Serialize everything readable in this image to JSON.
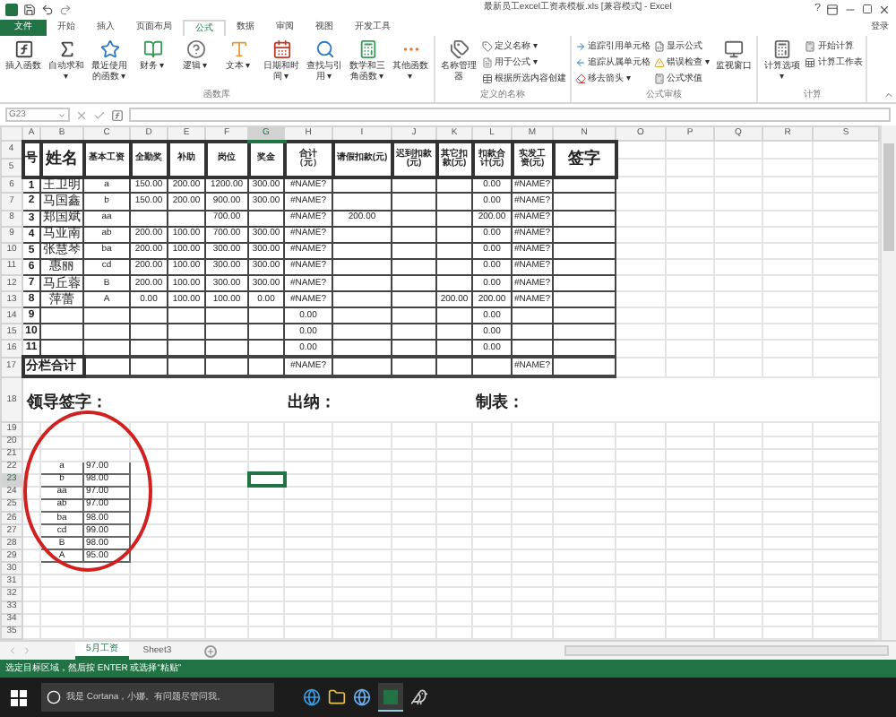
{
  "window": {
    "title": "最新员工excel工资表模板.xls [兼容模式] - Excel",
    "help": "?"
  },
  "tabs": [
    {
      "label": "文件",
      "kind": "file",
      "selected": false
    },
    {
      "label": "开始",
      "kind": "tab",
      "selected": false
    },
    {
      "label": "插入",
      "kind": "tab",
      "selected": false
    },
    {
      "label": "页面布局",
      "kind": "tab",
      "selected": false
    },
    {
      "label": "公式",
      "kind": "tab",
      "selected": true
    },
    {
      "label": "数据",
      "kind": "tab",
      "selected": false
    },
    {
      "label": "审阅",
      "kind": "tab",
      "selected": false
    },
    {
      "label": "视图",
      "kind": "tab",
      "selected": false
    },
    {
      "label": "开发工具",
      "kind": "tab",
      "selected": false
    }
  ],
  "sign_in": "登录",
  "ribbon": {
    "groups": [
      {
        "label": "函数库",
        "items": [
          {
            "kind": "large",
            "labels": [
              "插入函数"
            ]
          },
          {
            "kind": "large",
            "labels": [
              "自动求和 ▾"
            ]
          },
          {
            "kind": "large",
            "labels": [
              "最近使用的函数 ▾"
            ]
          },
          {
            "kind": "large",
            "labels": [
              "财务 ▾"
            ]
          },
          {
            "kind": "large",
            "labels": [
              "逻辑 ▾"
            ]
          },
          {
            "kind": "large",
            "labels": [
              "文本 ▾"
            ]
          },
          {
            "kind": "large",
            "labels": [
              "日期和时间 ▾"
            ]
          },
          {
            "kind": "large",
            "labels": [
              "查找与引用 ▾"
            ]
          },
          {
            "kind": "large",
            "labels": [
              "数学和三角函数 ▾"
            ]
          },
          {
            "kind": "large",
            "labels": [
              "其他函数 ▾"
            ]
          }
        ]
      },
      {
        "label": "定义的名称",
        "items": [
          {
            "kind": "large",
            "labels": [
              "名称管理器"
            ]
          },
          {
            "kind": "stack",
            "labels": [
              "定义名称 ▾",
              "用于公式 ▾",
              "根据所选内容创建"
            ]
          }
        ]
      },
      {
        "label": "公式审核",
        "items": [
          {
            "kind": "stack",
            "labels": [
              "追踪引用单元格",
              "追踪从属单元格",
              "移去箭头 ▾"
            ]
          },
          {
            "kind": "stack",
            "labels": [
              "显示公式",
              "错误检查 ▾",
              "公式求值"
            ]
          },
          {
            "kind": "large",
            "labels": [
              "监视窗口"
            ]
          }
        ]
      },
      {
        "label": "计算",
        "items": [
          {
            "kind": "large",
            "labels": [
              "计算选项 ▾"
            ]
          },
          {
            "kind": "stack",
            "labels": [
              "开始计算",
              "计算工作表"
            ]
          }
        ]
      }
    ]
  },
  "formula_bar": {
    "name_box": "G23"
  },
  "sheet": {
    "columns": [
      {
        "label": "A",
        "selected": false
      },
      {
        "label": "B",
        "selected": false
      },
      {
        "label": "C",
        "selected": false
      },
      {
        "label": "D",
        "selected": false
      },
      {
        "label": "E",
        "selected": false
      },
      {
        "label": "F",
        "selected": false
      },
      {
        "label": "G",
        "selected": true
      },
      {
        "label": "H",
        "selected": false
      },
      {
        "label": "I",
        "selected": false
      },
      {
        "label": "J",
        "selected": false
      },
      {
        "label": "K",
        "selected": false
      },
      {
        "label": "L",
        "selected": false
      },
      {
        "label": "M",
        "selected": false
      },
      {
        "label": "N",
        "selected": false
      },
      {
        "label": "O",
        "selected": false
      },
      {
        "label": "P",
        "selected": false
      },
      {
        "label": "Q",
        "selected": false
      },
      {
        "label": "R",
        "selected": false
      },
      {
        "label": "S",
        "selected": false
      }
    ],
    "rows": [
      {
        "label": "4",
        "selected": false
      },
      {
        "label": "5",
        "selected": false
      },
      {
        "label": "6",
        "selected": false
      },
      {
        "label": "7",
        "selected": false
      },
      {
        "label": "8",
        "selected": false
      },
      {
        "label": "9",
        "selected": false
      },
      {
        "label": "10",
        "selected": false
      },
      {
        "label": "11",
        "selected": false
      },
      {
        "label": "12",
        "selected": false
      },
      {
        "label": "13",
        "selected": false
      },
      {
        "label": "14",
        "selected": false
      },
      {
        "label": "15",
        "selected": false
      },
      {
        "label": "16",
        "selected": false
      },
      {
        "label": "17",
        "selected": false
      },
      {
        "label": "18",
        "selected": false
      },
      {
        "label": "19",
        "selected": false
      },
      {
        "label": "20",
        "selected": false
      },
      {
        "label": "21",
        "selected": false
      },
      {
        "label": "22",
        "selected": false
      },
      {
        "label": "23",
        "selected": true
      },
      {
        "label": "24",
        "selected": false
      },
      {
        "label": "25",
        "selected": false
      },
      {
        "label": "26",
        "selected": false
      },
      {
        "label": "27",
        "selected": false
      },
      {
        "label": "28",
        "selected": false
      },
      {
        "label": "29",
        "selected": false
      },
      {
        "label": "30",
        "selected": false
      },
      {
        "label": "31",
        "selected": false
      },
      {
        "label": "32",
        "selected": false
      },
      {
        "label": "33",
        "selected": false
      },
      {
        "label": "34",
        "selected": false
      },
      {
        "label": "35",
        "selected": false
      }
    ],
    "table": {
      "header": {
        "A": "号",
        "B": "姓名",
        "C": "基本工资",
        "D": "全勤奖",
        "E": "补助",
        "F": "岗位",
        "G": "奖金",
        "H": "合计（元）",
        "I": "请假扣款(元)",
        "J": "迟到扣款(元)",
        "K": "其它扣款(元)",
        "L": "扣款合计(元)",
        "M": "实发工资(元)",
        "N": "签字"
      },
      "rows": [
        {
          "A": "1",
          "B": "王卫明",
          "C": "a",
          "D": "150.00",
          "E": "200.00",
          "F": "1200.00",
          "G": "300.00",
          "H": "#NAME?",
          "L": "0.00",
          "M": "#NAME?"
        },
        {
          "A": "2",
          "B": "马国鑫",
          "C": "b",
          "D": "150.00",
          "E": "200.00",
          "F": "900.00",
          "G": "300.00",
          "H": "#NAME?",
          "L": "0.00",
          "M": "#NAME?"
        },
        {
          "A": "3",
          "B": "郑国斌",
          "C": "aa",
          "F": "700.00",
          "H": "#NAME?",
          "I": "200.00",
          "L": "200.00",
          "M": "#NAME?"
        },
        {
          "A": "4",
          "B": "马亚南",
          "C": "ab",
          "D": "200.00",
          "E": "100.00",
          "F": "700.00",
          "G": "300.00",
          "H": "#NAME?",
          "L": "0.00",
          "M": "#NAME?"
        },
        {
          "A": "5",
          "B": "张慧琴",
          "C": "ba",
          "D": "200.00",
          "E": "100.00",
          "F": "300.00",
          "G": "300.00",
          "H": "#NAME?",
          "L": "0.00",
          "M": "#NAME?"
        },
        {
          "A": "6",
          "B": "惠丽",
          "C": "cd",
          "D": "200.00",
          "E": "100.00",
          "F": "300.00",
          "G": "300.00",
          "H": "#NAME?",
          "L": "0.00",
          "M": "#NAME?"
        },
        {
          "A": "7",
          "B": "马丘蓉",
          "C": "B",
          "D": "200.00",
          "E": "100.00",
          "F": "300.00",
          "G": "300.00",
          "H": "#NAME?",
          "L": "0.00",
          "M": "#NAME?"
        },
        {
          "A": "8",
          "B": "萍蕾",
          "C": "A",
          "D": "0.00",
          "E": "100.00",
          "F": "100.00",
          "G": "0.00",
          "H": "#NAME?",
          "K": "200.00",
          "L": "200.00",
          "M": "#NAME?"
        },
        {
          "A": "9",
          "H": "0.00",
          "L": "0.00"
        },
        {
          "A": "10",
          "H": "0.00",
          "L": "0.00"
        },
        {
          "A": "11",
          "H": "0.00",
          "L": "0.00"
        }
      ],
      "total": {
        "A": "分栏合计",
        "H": "#NAME?",
        "M": "#NAME?"
      }
    },
    "signatures": [
      "领导签字：",
      "出纳：",
      "制表："
    ],
    "grades": [
      {
        "code": "a",
        "score": "97.00"
      },
      {
        "code": "b",
        "score": "98.00"
      },
      {
        "code": "aa",
        "score": "97.00"
      },
      {
        "code": "ab",
        "score": "97.00"
      },
      {
        "code": "ba",
        "score": "98.00"
      },
      {
        "code": "cd",
        "score": "99.00"
      },
      {
        "code": "B",
        "score": "98.00"
      },
      {
        "code": "A",
        "score": "95.00"
      }
    ]
  },
  "sheet_tabs": [
    {
      "label": "5月工资",
      "selected": true
    },
    {
      "label": "Sheet3",
      "selected": false
    }
  ],
  "status_bar": "选定目标区域，然后按 ENTER 或选择“粘贴”",
  "taskbar": {
    "search_placeholder": "我是 Cortana，小娜。有问题尽管问我。"
  }
}
